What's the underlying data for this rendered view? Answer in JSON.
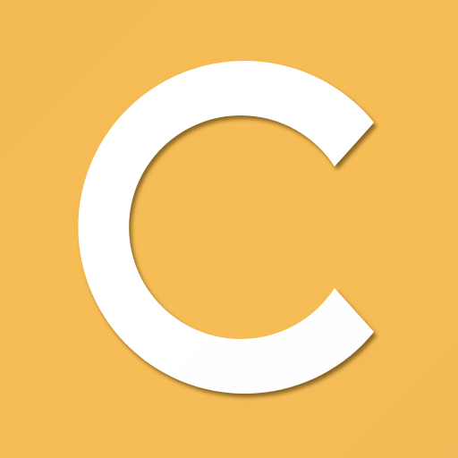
{
  "app_icon": {
    "letter": "C",
    "colors": {
      "background": "#F6BC55",
      "letter": "#FFFFFF",
      "shadow": "#7A5614"
    },
    "icon_name": "letter-c-logo-icon"
  }
}
